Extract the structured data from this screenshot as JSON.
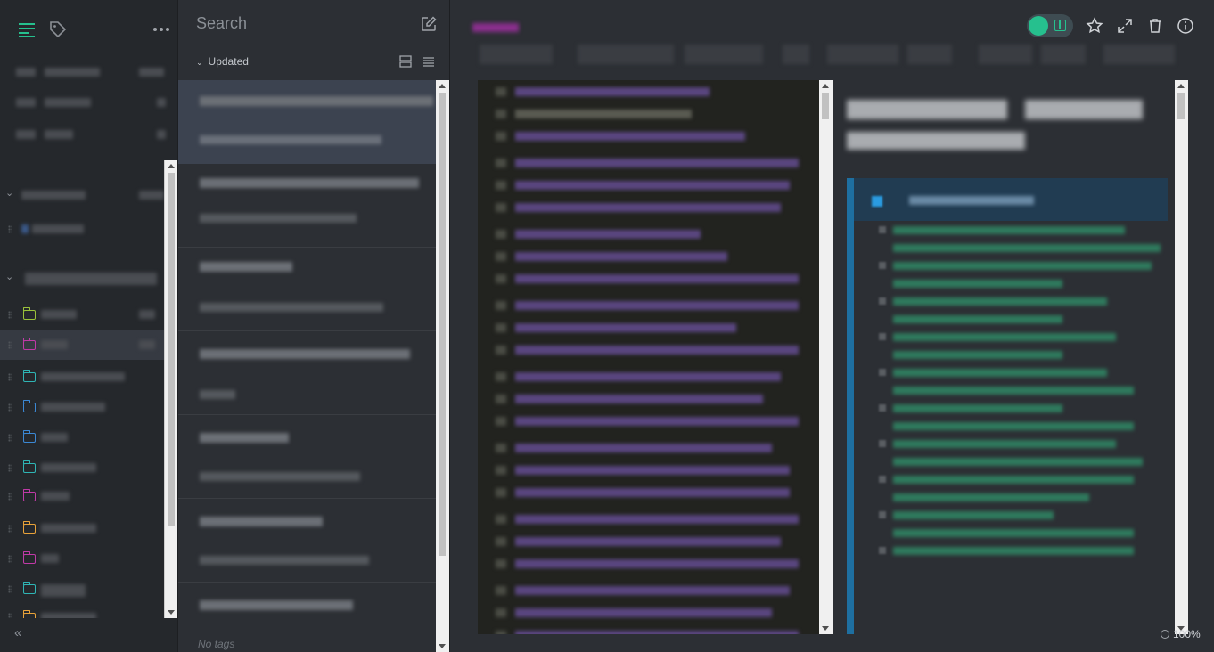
{
  "search": {
    "placeholder": "Search"
  },
  "list": {
    "sort_label": "Updated",
    "footer_tags": "No tags"
  },
  "main": {
    "zoom": "100%"
  },
  "icons": {
    "notes": "notes-list-icon",
    "tags": "tag-icon",
    "more": "more-dots-icon",
    "compose": "compose-icon",
    "collapse": "collapse-sidebar-icon",
    "star": "star-icon",
    "expand": "expand-icon",
    "trash": "trash-icon",
    "info": "info-icon",
    "split": "split-view-icon",
    "zoom": "zoom-icon"
  },
  "colors": {
    "accent": "#26c08e",
    "folder_green": "#9bc23b",
    "folder_pink": "#c03aa7",
    "folder_cyan": "#2fb5b5",
    "folder_blue": "#3b88d4",
    "folder_orange": "#e8a23a"
  }
}
